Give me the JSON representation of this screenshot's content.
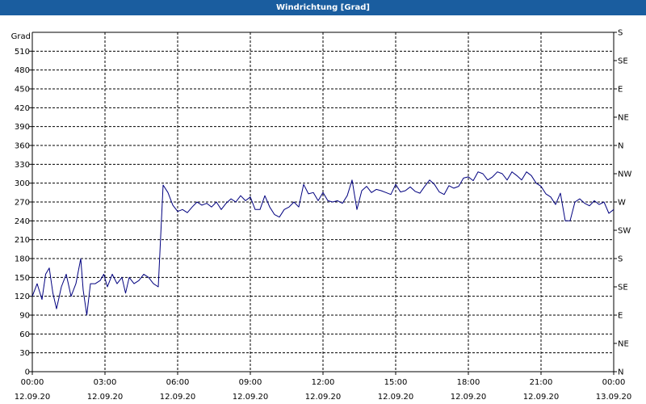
{
  "window": {
    "title": "Windrichtung [Grad]"
  },
  "chart_data": {
    "type": "line",
    "title": "Windrichtung [Grad]",
    "ylabel": "Grad",
    "xlabel": "",
    "ylim": [
      0,
      540
    ],
    "y_ticks": [
      0,
      30,
      60,
      90,
      120,
      150,
      180,
      210,
      240,
      270,
      300,
      330,
      360,
      390,
      420,
      450,
      480,
      510
    ],
    "y2_ticks": [
      "N",
      "NE",
      "E",
      "SE",
      "S",
      "SW",
      "W",
      "NW",
      "N",
      "NE",
      "E",
      "SE",
      "S"
    ],
    "x_range_hours": [
      0,
      24
    ],
    "x_ticks": [
      {
        "time": "00:00",
        "date": "12.09.20"
      },
      {
        "time": "03:00",
        "date": "12.09.20"
      },
      {
        "time": "06:00",
        "date": "12.09.20"
      },
      {
        "time": "09:00",
        "date": "12.09.20"
      },
      {
        "time": "12:00",
        "date": "12.09.20"
      },
      {
        "time": "15:00",
        "date": "12.09.20"
      },
      {
        "time": "18:00",
        "date": "12.09.20"
      },
      {
        "time": "21:00",
        "date": "12.09.20"
      },
      {
        "time": "00:00",
        "date": "13.09.20"
      }
    ],
    "grid": true,
    "line_color": "#00007f",
    "series": [
      {
        "x_hours": [
          0.0,
          0.2,
          0.4,
          0.55,
          0.7,
          0.85,
          1.0,
          1.2,
          1.4,
          1.6,
          1.8,
          2.0,
          2.1,
          2.25,
          2.4,
          2.6,
          2.8,
          2.95,
          3.1,
          3.3,
          3.5,
          3.7,
          3.85,
          4.0,
          4.2,
          4.4,
          4.6,
          4.8,
          5.0,
          5.2,
          5.4,
          5.6,
          5.8,
          6.0,
          6.2,
          6.4,
          6.6,
          6.8,
          7.0,
          7.2,
          7.4,
          7.6,
          7.8,
          8.0,
          8.2,
          8.4,
          8.6,
          8.8,
          9.0,
          9.2,
          9.4,
          9.6,
          9.8,
          10.0,
          10.2,
          10.4,
          10.6,
          10.8,
          11.0,
          11.2,
          11.4,
          11.6,
          11.8,
          12.0,
          12.2,
          12.4,
          12.6,
          12.8,
          13.0,
          13.2,
          13.4,
          13.6,
          13.8,
          14.0,
          14.2,
          14.4,
          14.6,
          14.8,
          15.0,
          15.2,
          15.4,
          15.6,
          15.8,
          16.0,
          16.2,
          16.4,
          16.6,
          16.8,
          17.0,
          17.2,
          17.4,
          17.6,
          17.8,
          18.0,
          18.2,
          18.4,
          18.6,
          18.8,
          19.0,
          19.2,
          19.4,
          19.6,
          19.8,
          20.0,
          20.2,
          20.4,
          20.6,
          20.8,
          21.0,
          21.2,
          21.4,
          21.6,
          21.8,
          22.0,
          22.2,
          22.4,
          22.6,
          22.8,
          23.0,
          23.2,
          23.4,
          23.6,
          23.8,
          24.0
        ],
        "values": [
          120,
          140,
          115,
          155,
          165,
          125,
          100,
          135,
          155,
          120,
          140,
          180,
          130,
          90,
          140,
          140,
          145,
          155,
          135,
          155,
          140,
          150,
          125,
          150,
          140,
          145,
          155,
          150,
          140,
          135,
          297,
          285,
          265,
          255,
          258,
          253,
          262,
          270,
          265,
          268,
          262,
          270,
          258,
          268,
          275,
          270,
          280,
          272,
          278,
          258,
          258,
          280,
          262,
          250,
          246,
          258,
          262,
          270,
          262,
          298,
          283,
          285,
          272,
          285,
          272,
          270,
          272,
          268,
          280,
          305,
          258,
          288,
          295,
          285,
          290,
          288,
          285,
          282,
          298,
          286,
          288,
          294,
          287,
          284,
          295,
          305,
          298,
          286,
          282,
          296,
          292,
          295,
          308,
          310,
          304,
          318,
          315,
          305,
          310,
          318,
          315,
          305,
          318,
          312,
          305,
          318,
          312,
          300,
          295,
          283,
          278,
          266,
          284,
          240,
          240,
          270,
          275,
          268,
          264,
          272,
          266,
          270,
          252,
          258,
          250,
          246,
          228,
          232,
          234,
          228
        ]
      }
    ]
  }
}
